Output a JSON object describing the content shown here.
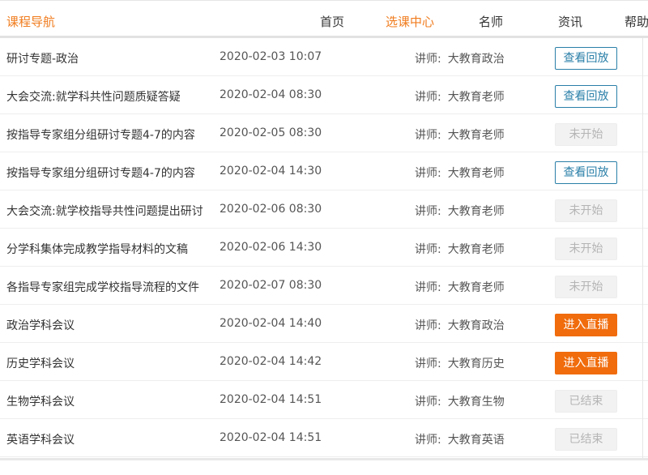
{
  "nav": {
    "title": "课程导航",
    "items": [
      {
        "label": "首页"
      },
      {
        "label": "选课中心"
      },
      {
        "label": "名师"
      },
      {
        "label": "资讯"
      },
      {
        "label": "帮助"
      }
    ]
  },
  "sessions": [
    {
      "title": "研讨专题-政治",
      "time": "2020-02-03 10:07",
      "teacher_prefix": "讲师:",
      "teacher": "大教育政治",
      "action": "查看回放",
      "status": "replay"
    },
    {
      "title": "大会交流:就学科共性问题质疑答疑",
      "time": "2020-02-04 08:30",
      "teacher_prefix": "讲师:",
      "teacher": "大教育老师",
      "action": "查看回放",
      "status": "replay"
    },
    {
      "title": "按指导专家组分组研讨专题4-7的内容",
      "time": "2020-02-05 08:30",
      "teacher_prefix": "讲师:",
      "teacher": "大教育老师",
      "action": "未开始",
      "status": "notstarted"
    },
    {
      "title": "按指导专家组分组研讨专题4-7的内容",
      "time": "2020-02-04 14:30",
      "teacher_prefix": "讲师:",
      "teacher": "大教育老师",
      "action": "查看回放",
      "status": "replay"
    },
    {
      "title": "大会交流:就学校指导共性问题提出研讨",
      "time": "2020-02-06 08:30",
      "teacher_prefix": "讲师:",
      "teacher": "大教育老师",
      "action": "未开始",
      "status": "notstarted"
    },
    {
      "title": "分学科集体完成教学指导材料的文稿",
      "time": "2020-02-06 14:30",
      "teacher_prefix": "讲师:",
      "teacher": "大教育老师",
      "action": "未开始",
      "status": "notstarted"
    },
    {
      "title": "各指导专家组完成学校指导流程的文件",
      "time": "2020-02-07 08:30",
      "teacher_prefix": "讲师:",
      "teacher": "大教育老师",
      "action": "未开始",
      "status": "notstarted"
    },
    {
      "title": "政治学科会议",
      "time": "2020-02-04 14:40",
      "teacher_prefix": "讲师:",
      "teacher": "大教育政治",
      "action": "进入直播",
      "status": "live"
    },
    {
      "title": "历史学科会议",
      "time": "2020-02-04 14:42",
      "teacher_prefix": "讲师:",
      "teacher": "大教育历史",
      "action": "进入直播",
      "status": "live"
    },
    {
      "title": "生物学科会议",
      "time": "2020-02-04 14:51",
      "teacher_prefix": "讲师:",
      "teacher": "大教育生物",
      "action": "已结束",
      "status": "ended"
    },
    {
      "title": "英语学科会议",
      "time": "2020-02-04 14:51",
      "teacher_prefix": "讲师:",
      "teacher": "大教育英语",
      "action": "已结束",
      "status": "ended"
    }
  ],
  "colors": {
    "accent": "#f07c1e",
    "replay": "#2a7fa8",
    "live": "#f06c0c",
    "disabled_bg": "#f2f2f2",
    "disabled_text": "#b5b5b5"
  }
}
